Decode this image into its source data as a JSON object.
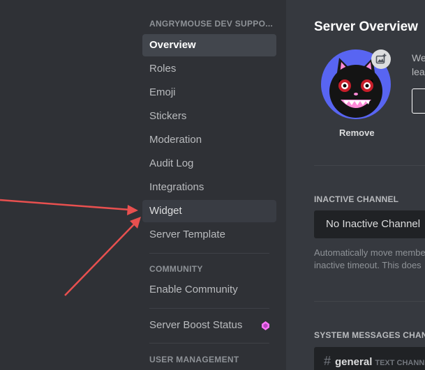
{
  "sidebar": {
    "server_header": "ANGRYMOUSE DEV SUPPO...",
    "items": [
      {
        "label": "Overview"
      },
      {
        "label": "Roles"
      },
      {
        "label": "Emoji"
      },
      {
        "label": "Stickers"
      },
      {
        "label": "Moderation"
      },
      {
        "label": "Audit Log"
      },
      {
        "label": "Integrations"
      },
      {
        "label": "Widget"
      },
      {
        "label": "Server Template"
      }
    ],
    "community_header": "COMMUNITY",
    "enable_community": "Enable Community",
    "boost_status": "Server Boost Status",
    "user_management_header": "USER MANAGEMENT"
  },
  "main": {
    "title": "Server Overview",
    "remove_label": "Remove",
    "upload_text_line1": "We",
    "upload_text_line2": "leas",
    "inactive": {
      "header": "INACTIVE CHANNEL",
      "value": "No Inactive Channel",
      "help_line1": "Automatically move membe",
      "help_line2": "inactive timeout. This does"
    },
    "system_messages": {
      "header": "SYSTEM MESSAGES CHANN",
      "channel_name": "general",
      "channel_kind": "TEXT CHANN"
    }
  },
  "colors": {
    "accent": "#5865f2",
    "annotation_arrow": "#e8504f",
    "boost_gem": "#ff73fa"
  },
  "icons": {
    "upload": "image-plus-icon",
    "boost": "boost-gem-icon",
    "channel": "hash-icon"
  }
}
